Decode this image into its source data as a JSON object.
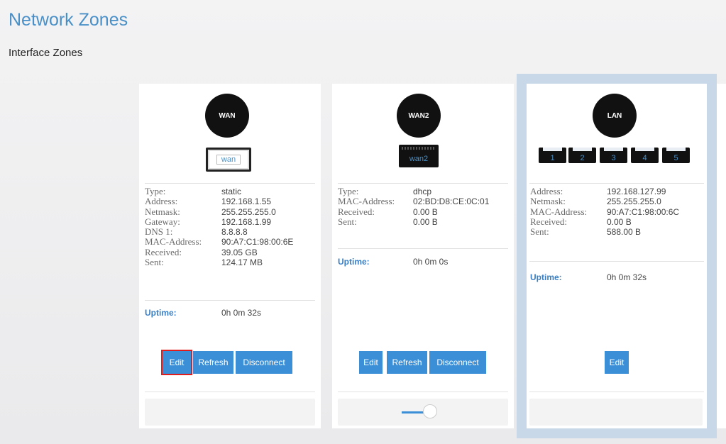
{
  "page": {
    "title": "Network Zones",
    "section": "Interface Zones"
  },
  "cards": [
    {
      "zone": "WAN",
      "port_label": "wan",
      "info": [
        [
          "Type:",
          "static"
        ],
        [
          "Address:",
          "192.168.1.55"
        ],
        [
          "Netmask:",
          "255.255.255.0"
        ],
        [
          "Gateway:",
          "192.168.1.99"
        ],
        [
          "DNS 1:",
          "8.8.8.8"
        ],
        [
          "MAC-Address:",
          "90:A7:C1:98:00:6E"
        ],
        [
          "Received:",
          "39.05 GB"
        ],
        [
          "Sent:",
          "124.17 MB"
        ]
      ],
      "uptime_label": "Uptime:",
      "uptime": "0h 0m 32s",
      "buttons": {
        "edit": "Edit",
        "refresh": "Refresh",
        "disconnect": "Disconnect"
      }
    },
    {
      "zone": "WAN2",
      "port_label": "wan2",
      "info": [
        [
          "Type:",
          "dhcp"
        ],
        [
          "MAC-Address:",
          "02:BD:D8:CE:0C:01"
        ],
        [
          "Received:",
          "0.00 B"
        ],
        [
          "Sent:",
          "0.00 B"
        ]
      ],
      "uptime_label": "Uptime:",
      "uptime": "0h 0m 0s",
      "buttons": {
        "edit": "Edit",
        "refresh": "Refresh",
        "disconnect": "Disconnect"
      },
      "toggle": {
        "state": "on"
      }
    },
    {
      "zone": "LAN",
      "ports": [
        "1",
        "2",
        "3",
        "4",
        "5"
      ],
      "info": [
        [
          "Address:",
          "192.168.127.99"
        ],
        [
          "Netmask:",
          "255.255.255.0"
        ],
        [
          "MAC-Address:",
          "90:A7:C1:98:00:6C"
        ],
        [
          "Received:",
          "0.00 B"
        ],
        [
          "Sent:",
          "588.00 B"
        ]
      ],
      "uptime_label": "Uptime:",
      "uptime": "0h 0m 32s",
      "buttons": {
        "edit": "Edit"
      }
    }
  ],
  "colors": {
    "accent": "#3b8fd7",
    "title": "#4a90c8",
    "selected_border": "#c9d8e8",
    "highlight": "#e01d1d"
  }
}
